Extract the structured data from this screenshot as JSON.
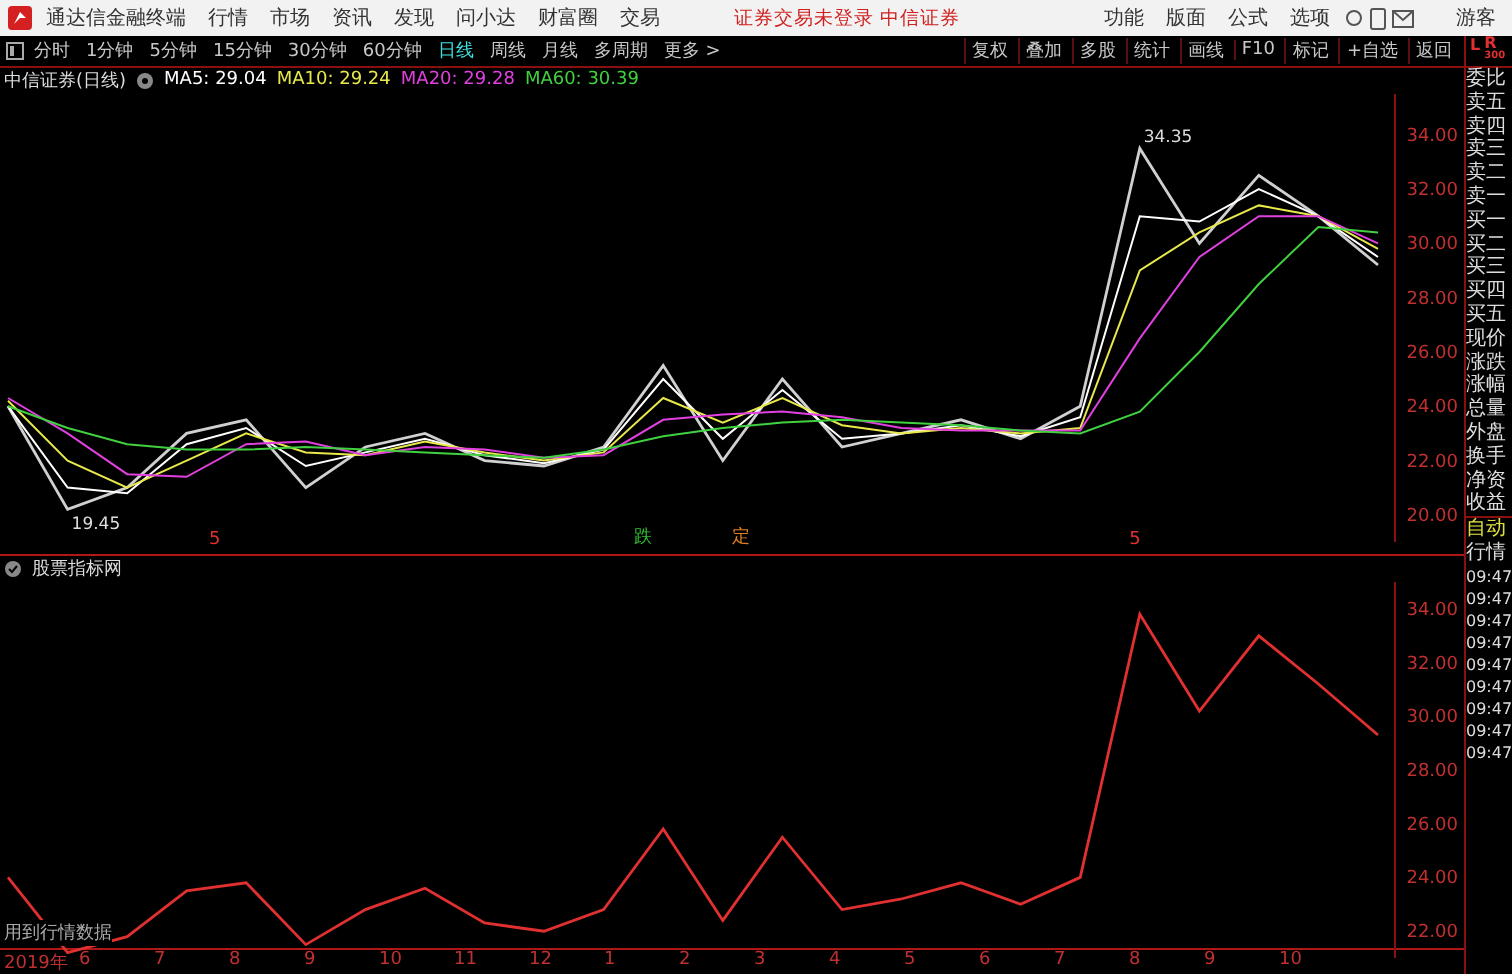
{
  "title_bar": {
    "app_name": "通达信金融终端",
    "menus": [
      "行情",
      "市场",
      "资讯",
      "发现",
      "问小达",
      "财富圈",
      "交易"
    ],
    "login_status": "证券交易未登录",
    "broker": "中信证券",
    "right_menus": [
      "功能",
      "版面",
      "公式",
      "选项"
    ],
    "user": "游客"
  },
  "period_tabs": [
    {
      "label": "分时",
      "selected": false
    },
    {
      "label": "1分钟",
      "selected": false
    },
    {
      "label": "5分钟",
      "selected": false
    },
    {
      "label": "15分钟",
      "selected": false
    },
    {
      "label": "30分钟",
      "selected": false
    },
    {
      "label": "60分钟",
      "selected": false
    },
    {
      "label": "日线",
      "selected": true
    },
    {
      "label": "周线",
      "selected": false
    },
    {
      "label": "月线",
      "selected": false
    },
    {
      "label": "多周期",
      "selected": false
    },
    {
      "label": "更多 >",
      "selected": false
    }
  ],
  "tools": [
    "复权",
    "叠加",
    "多股",
    "统计",
    "画线",
    "F10",
    "标记",
    "+自选",
    "返回"
  ],
  "side_header": {
    "left": "L",
    "right": "R",
    "sub": "300"
  },
  "main_chart": {
    "title": "中信证券(日线)",
    "indicators": [
      {
        "label": "MA5: 29.04",
        "color": "#ffffff"
      },
      {
        "label": "MA10: 29.24",
        "color": "#e8e84a"
      },
      {
        "label": "MA20: 29.28",
        "color": "#e040e0"
      },
      {
        "label": "MA60: 30.39",
        "color": "#40d040"
      }
    ],
    "markers": [
      {
        "text": "5",
        "color": "#e03030"
      },
      {
        "text": "跌",
        "color": "#30c030"
      },
      {
        "text": "定",
        "color": "#e08020"
      },
      {
        "text": "5",
        "color": "#e03030"
      }
    ],
    "chart_data": {
      "type": "line",
      "ylim": [
        19,
        35.5
      ],
      "yticks": [
        {
          "value": 20,
          "label": "20.00"
        },
        {
          "value": 22,
          "label": "22.00"
        },
        {
          "value": 24,
          "label": "24.00"
        },
        {
          "value": 26,
          "label": "26.00"
        },
        {
          "value": 28,
          "label": "28.00"
        },
        {
          "value": 30,
          "label": "30.00"
        },
        {
          "value": 32,
          "label": "32.00"
        },
        {
          "value": 34,
          "label": "34.00"
        }
      ],
      "annotations": [
        "34.35",
        "19.45"
      ],
      "series": [
        {
          "color": "#d0d0d0",
          "values": [
            24,
            20.2,
            21,
            23,
            23.5,
            21,
            22.5,
            23,
            22,
            21.8,
            22.5,
            25.5,
            22,
            25,
            22.5,
            23,
            23.5,
            22.8,
            24,
            33.5,
            30,
            32.5,
            31,
            29.2
          ]
        },
        {
          "color": "#ffffff",
          "values": [
            24,
            21,
            20.8,
            22.6,
            23.2,
            21.8,
            22.3,
            22.8,
            22.2,
            21.9,
            22.4,
            25,
            22.8,
            24.6,
            22.8,
            23,
            23.3,
            22.9,
            23.6,
            31,
            30.8,
            32,
            31,
            29.5
          ]
        },
        {
          "color": "#e8e84a",
          "values": [
            24.2,
            22,
            21,
            22,
            23,
            22.3,
            22.2,
            22.7,
            22.3,
            22,
            22.3,
            24.3,
            23.4,
            24.3,
            23.3,
            23,
            23.2,
            23,
            23.2,
            29,
            30.4,
            31.4,
            31,
            29.8
          ]
        },
        {
          "color": "#e040e0",
          "values": [
            24.3,
            23,
            21.5,
            21.4,
            22.6,
            22.7,
            22.2,
            22.5,
            22.4,
            22.1,
            22.2,
            23.5,
            23.7,
            23.8,
            23.6,
            23.2,
            23.1,
            23.1,
            23.1,
            26.5,
            29.5,
            31,
            31,
            30
          ]
        },
        {
          "color": "#40d040",
          "values": [
            24,
            23.2,
            22.6,
            22.4,
            22.4,
            22.5,
            22.4,
            22.3,
            22.2,
            22.1,
            22.4,
            22.9,
            23.2,
            23.4,
            23.5,
            23.4,
            23.3,
            23.1,
            23,
            23.8,
            26,
            28.5,
            30.6,
            30.4
          ]
        }
      ]
    }
  },
  "sub_chart": {
    "title": "股票指标网",
    "note": "用到行情数据",
    "chart_data": {
      "type": "line",
      "ylim": [
        21,
        35
      ],
      "yticks": [
        {
          "value": 22,
          "label": "22.00"
        },
        {
          "value": 24,
          "label": "24.00"
        },
        {
          "value": 26,
          "label": "26.00"
        },
        {
          "value": 28,
          "label": "28.00"
        },
        {
          "value": 30,
          "label": "30.00"
        },
        {
          "value": 32,
          "label": "32.00"
        },
        {
          "value": 34,
          "label": "34.00"
        }
      ],
      "series": [
        {
          "color": "#e03030",
          "values": [
            24,
            21.2,
            21.8,
            23.5,
            23.8,
            21.5,
            22.8,
            23.6,
            22.3,
            22,
            22.8,
            25.8,
            22.4,
            25.5,
            22.8,
            23.2,
            23.8,
            23,
            24,
            33.8,
            30.2,
            33,
            31.2,
            29.3
          ]
        }
      ]
    }
  },
  "x_axis": [
    "2019年",
    "6",
    "7",
    "8",
    "9",
    "10",
    "11",
    "12",
    "1",
    "2",
    "3",
    "4",
    "5",
    "6",
    "7",
    "8",
    "9",
    "10"
  ],
  "quote_labels": [
    "委比",
    "卖五",
    "卖四",
    "卖三",
    "卖二",
    "卖一",
    "买一",
    "买二",
    "买三",
    "买四",
    "买五",
    "现价",
    "涨跌",
    "涨幅",
    "总量",
    "外盘",
    "换手",
    "净资",
    "收益"
  ],
  "ticker": {
    "mode": "自动",
    "title": "行情",
    "times": [
      "09:47",
      "09:47",
      "09:47",
      "09:47",
      "09:47",
      "09:47",
      "09:47",
      "09:47",
      "09:47"
    ]
  }
}
